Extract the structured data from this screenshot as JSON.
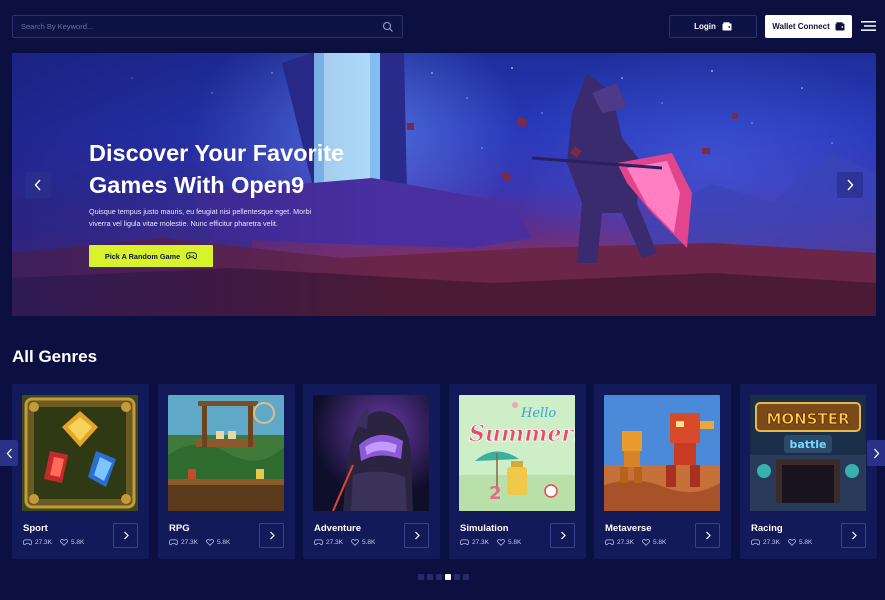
{
  "header": {
    "search": {
      "placeholder": "Search By Keyword...",
      "value": "",
      "icon": "search-icon"
    },
    "login_label": "Login",
    "wallet_label": "Wallet Connect",
    "menu_icon": "hamburger-icon"
  },
  "hero": {
    "title_line1": "Discover Your Favorite",
    "title_line2": "Games With Open9",
    "description_line1": "Quisque tempus justo mauris, eu feugiat nisi pellentesque eget. Morbi",
    "description_line2": "viverra vel ligula vitae molestie. Nunc efficitur pharetra velit.",
    "cta_label": "Pick A Random Game",
    "cta_color": "#d8f22b"
  },
  "genres": {
    "title": "All Genres",
    "items": [
      {
        "name": "Sport",
        "plays": "27.3K",
        "likes": "5.8K"
      },
      {
        "name": "RPG",
        "plays": "27.3K",
        "likes": "5.8K"
      },
      {
        "name": "Adventure",
        "plays": "27.3K",
        "likes": "5.8K"
      },
      {
        "name": "Simulation",
        "plays": "27.3K",
        "likes": "5.8K",
        "art_text_1": "Hello",
        "art_text_2": "Summer!"
      },
      {
        "name": "Metaverse",
        "plays": "27.3K",
        "likes": "5.8K"
      },
      {
        "name": "Racing",
        "plays": "27.3K",
        "likes": "5.8K",
        "art_text_1": "MONSTER",
        "art_text_2": "battle"
      }
    ]
  },
  "pagination": {
    "pages": 6,
    "active_page": 4
  },
  "colors": {
    "background": "#0b1040",
    "card": "#131a5a",
    "accent": "#d8f22b"
  }
}
